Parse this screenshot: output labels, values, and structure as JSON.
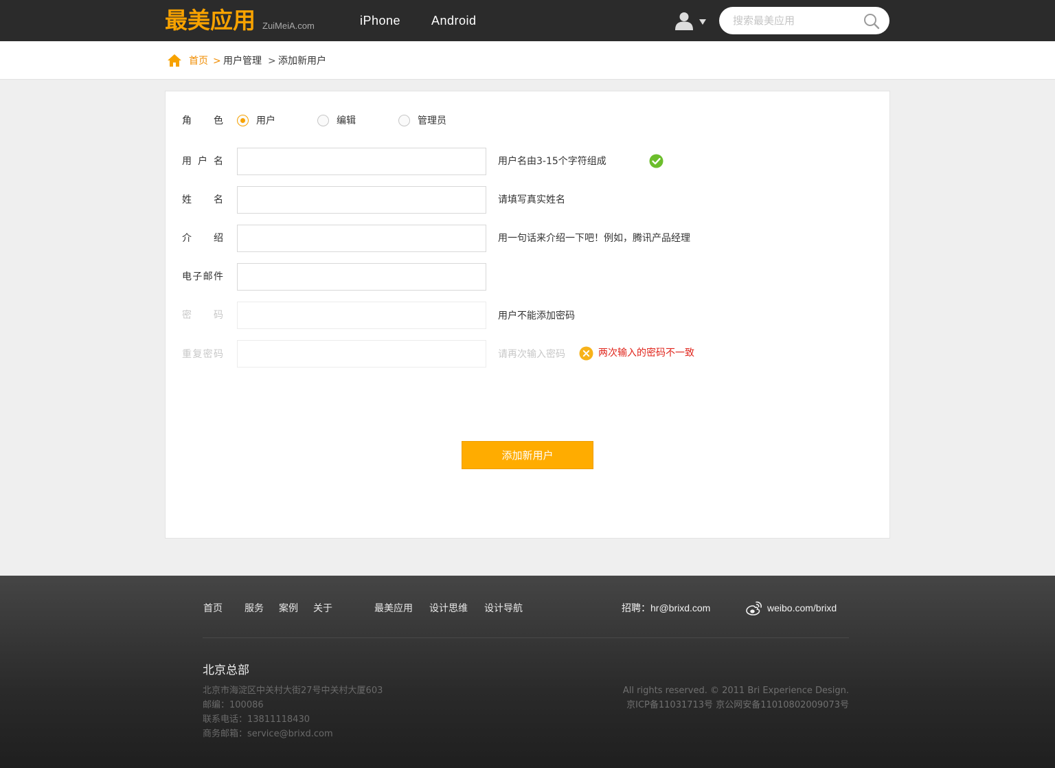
{
  "header": {
    "logo_cn": "最美应用",
    "logo_en": "ZuiMeiA.com",
    "nav": [
      "iPhone",
      "Android"
    ],
    "search_placeholder": "搜索最美应用"
  },
  "breadcrumb": {
    "home": "首页",
    "sep": ">",
    "items": [
      "用户管理",
      "添加新用户"
    ]
  },
  "form": {
    "role": {
      "label": "角色",
      "options": [
        "用户",
        "编辑",
        "管理员"
      ],
      "selected": "用户"
    },
    "username": {
      "label": "用户名",
      "value": "",
      "hint": "用户名由3-15个字符组成"
    },
    "realname": {
      "label": "姓名",
      "value": "",
      "hint": "请填写真实姓名"
    },
    "intro": {
      "label": "介绍",
      "value": "",
      "hint": "用一句话来介绍一下吧！例如，腾讯产品经理"
    },
    "email": {
      "label": "电子邮件",
      "value": ""
    },
    "password": {
      "label": "密码",
      "value": "",
      "hint": "用户不能添加密码"
    },
    "password_repeat": {
      "label": "重复密码",
      "value": "",
      "hint": "请再次输入密码",
      "error": "两次输入的密码不一致"
    },
    "submit_label": "添加新用户"
  },
  "footer": {
    "links_left": [
      "首页",
      "服务",
      "案例",
      "关于"
    ],
    "links_mid": [
      "最美应用",
      "设计思维",
      "设计导航"
    ],
    "recruit": "招聘：hr@brixd.com",
    "weibo": "weibo.com/brixd",
    "hq_title": "北京总部",
    "address_lines": [
      "北京市海淀区中关村大街27号中关村大厦603",
      "邮编：100086",
      "联系电话：13811118430",
      "商务邮箱：service@brixd.com"
    ],
    "copyright": "All rights reserved. © 2011 Bri Experience Design.",
    "icp": "京ICP备11031713号 京公网安备11010802009073号"
  },
  "colors": {
    "brand_orange": "#f7a200",
    "button_orange": "#ffac00",
    "error_red": "#e0241b",
    "success_green": "#6cbe2c"
  }
}
